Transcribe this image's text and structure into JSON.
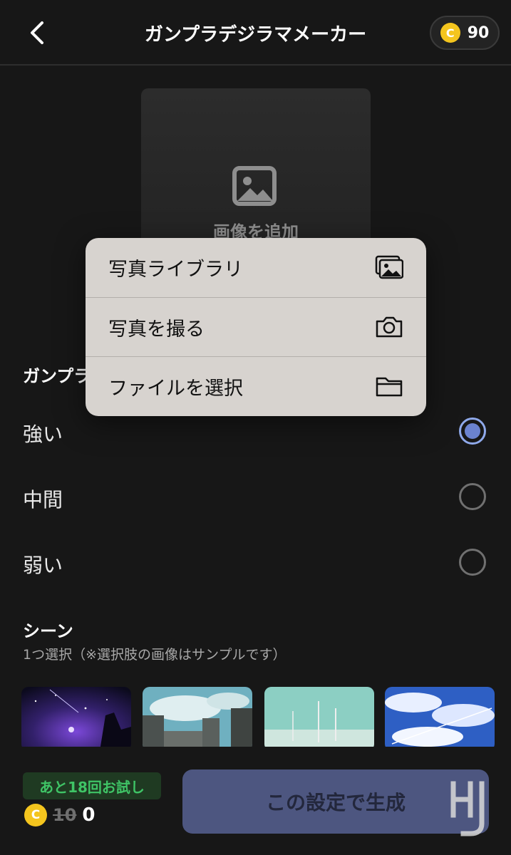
{
  "header": {
    "title": "ガンプラデジラマメーカー",
    "coin_symbol": "C",
    "coin_balance": "90",
    "back_icon": "chevron-left-icon"
  },
  "upload": {
    "label": "画像を追加",
    "icon": "image-icon"
  },
  "strength": {
    "heading": "ガンプラ",
    "options": [
      {
        "label": "強い",
        "selected": true
      },
      {
        "label": "中間",
        "selected": false
      },
      {
        "label": "弱い",
        "selected": false
      }
    ]
  },
  "scene": {
    "title": "シーン",
    "subtitle": "1つ選択（※選択肢の画像はサンプルです）"
  },
  "bottom": {
    "trial_badge": "あと18回お試し",
    "coin_symbol": "C",
    "old_price": "10",
    "new_price": "0",
    "generate_label": "この設定で生成"
  },
  "menu": {
    "items": [
      {
        "label": "写真ライブラリ",
        "icon": "photo-library-icon"
      },
      {
        "label": "写真を撮る",
        "icon": "camera-icon"
      },
      {
        "label": "ファイルを選択",
        "icon": "folder-icon"
      }
    ]
  },
  "colors": {
    "accent": "#6b83cf",
    "coin": "#f4c51e",
    "trial_text": "#3fc466",
    "button": "#4d5680"
  }
}
